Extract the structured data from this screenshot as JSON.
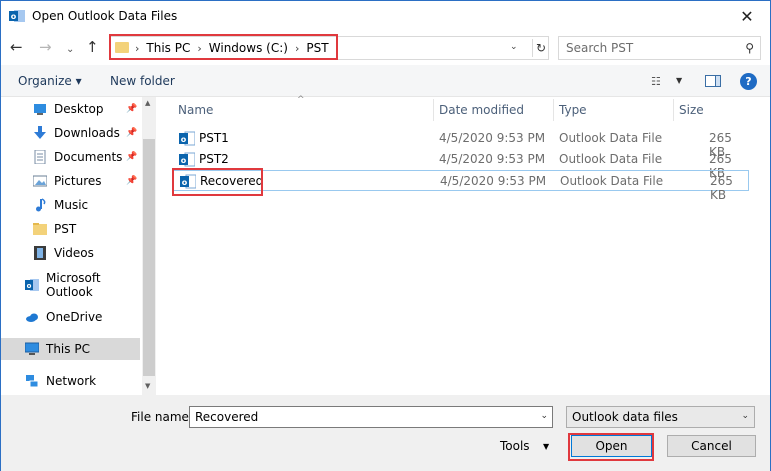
{
  "window": {
    "title": "Open Outlook Data Files",
    "close_glyph": "✕"
  },
  "nav": {
    "back_glyph": "←",
    "forward_glyph": "→",
    "recent_glyph": "⌄",
    "up_glyph": "↑"
  },
  "address": {
    "crumbs": [
      "This PC",
      "Windows (C:)",
      "PST"
    ],
    "separator": "›",
    "dropdown_glyph": "⌄",
    "refresh_glyph": "↻"
  },
  "search": {
    "placeholder": "Search PST",
    "icon_glyph": "⚲"
  },
  "toolbar": {
    "organize_label": "Organize ▾",
    "new_folder_label": "New folder",
    "view_glyph": "☷",
    "view_dropdown_glyph": "▼",
    "help_glyph": "?"
  },
  "sidebar": {
    "items": [
      {
        "label": "Desktop",
        "pinned": true
      },
      {
        "label": "Downloads",
        "pinned": true
      },
      {
        "label": "Documents",
        "pinned": true
      },
      {
        "label": "Pictures",
        "pinned": true
      },
      {
        "label": "Music",
        "pinned": false
      },
      {
        "label": "PST",
        "pinned": false
      },
      {
        "label": "Videos",
        "pinned": false
      },
      {
        "label": "Microsoft Outlook",
        "pinned": false
      },
      {
        "label": "OneDrive",
        "pinned": false
      },
      {
        "label": "This PC",
        "pinned": false,
        "selected": true
      },
      {
        "label": "Network",
        "pinned": false
      }
    ],
    "pin_glyph": "📌",
    "scroll_up_glyph": "▲",
    "scroll_down_glyph": "▼"
  },
  "files": {
    "columns": [
      "Name",
      "Date modified",
      "Type",
      "Size"
    ],
    "sort_glyph": "^",
    "rows": [
      {
        "name": "PST1",
        "date": "4/5/2020 9:53 PM",
        "type": "Outlook Data File",
        "size": "265 KB"
      },
      {
        "name": "PST2",
        "date": "4/5/2020 9:53 PM",
        "type": "Outlook Data File",
        "size": "265 KB"
      },
      {
        "name": "Recovered",
        "date": "4/5/2020 9:53 PM",
        "type": "Outlook Data File",
        "size": "265 KB"
      }
    ]
  },
  "footer": {
    "file_name_label": "File name:",
    "file_name_value": "Recovered",
    "file_type_value": "Outlook data files",
    "tools_label": "Tools",
    "open_label": "Open",
    "cancel_label": "Cancel",
    "dropdown_glyph": "⌄",
    "tools_dropdown_glyph": "▼"
  },
  "colors": {
    "highlight_red": "#e0393e",
    "accent_blue": "#0078d7",
    "outlook_blue": "#0a64ad"
  }
}
